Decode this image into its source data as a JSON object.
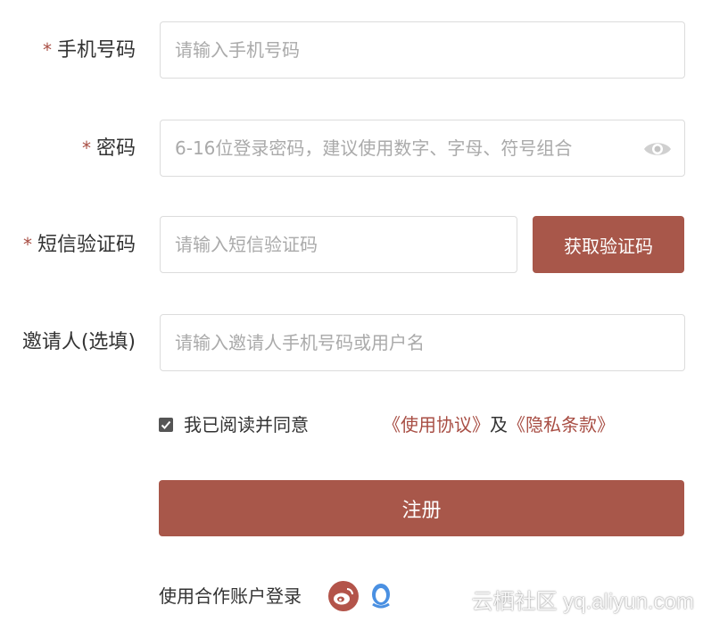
{
  "form": {
    "phone": {
      "required_mark": "*",
      "label": "手机号码",
      "placeholder": "请输入手机号码"
    },
    "password": {
      "required_mark": "*",
      "label": "密码",
      "placeholder": "6-16位登录密码，建议使用数字、字母、符号组合",
      "toggle_icon": "eye-icon"
    },
    "sms_code": {
      "required_mark": "*",
      "label": "短信验证码",
      "placeholder": "请输入短信验证码",
      "button_label": "获取验证码"
    },
    "inviter": {
      "label": "邀请人(选填)",
      "placeholder": "请输入邀请人手机号码或用户名"
    }
  },
  "agreement": {
    "checked": true,
    "text": "我已阅读并同意",
    "terms_link": "《使用协议》",
    "and_text": "及",
    "privacy_link": "《隐私条款》"
  },
  "register_button": "注册",
  "partner_login": {
    "label": "使用合作账户登录",
    "icons": [
      "weibo-icon",
      "qq-icon"
    ]
  },
  "watermark": "云栖社区 yq.aliyun.com",
  "colors": {
    "accent": "#a8574a",
    "required": "#a84e44",
    "border": "#dcdcdc",
    "qq": "#4a90e2"
  }
}
